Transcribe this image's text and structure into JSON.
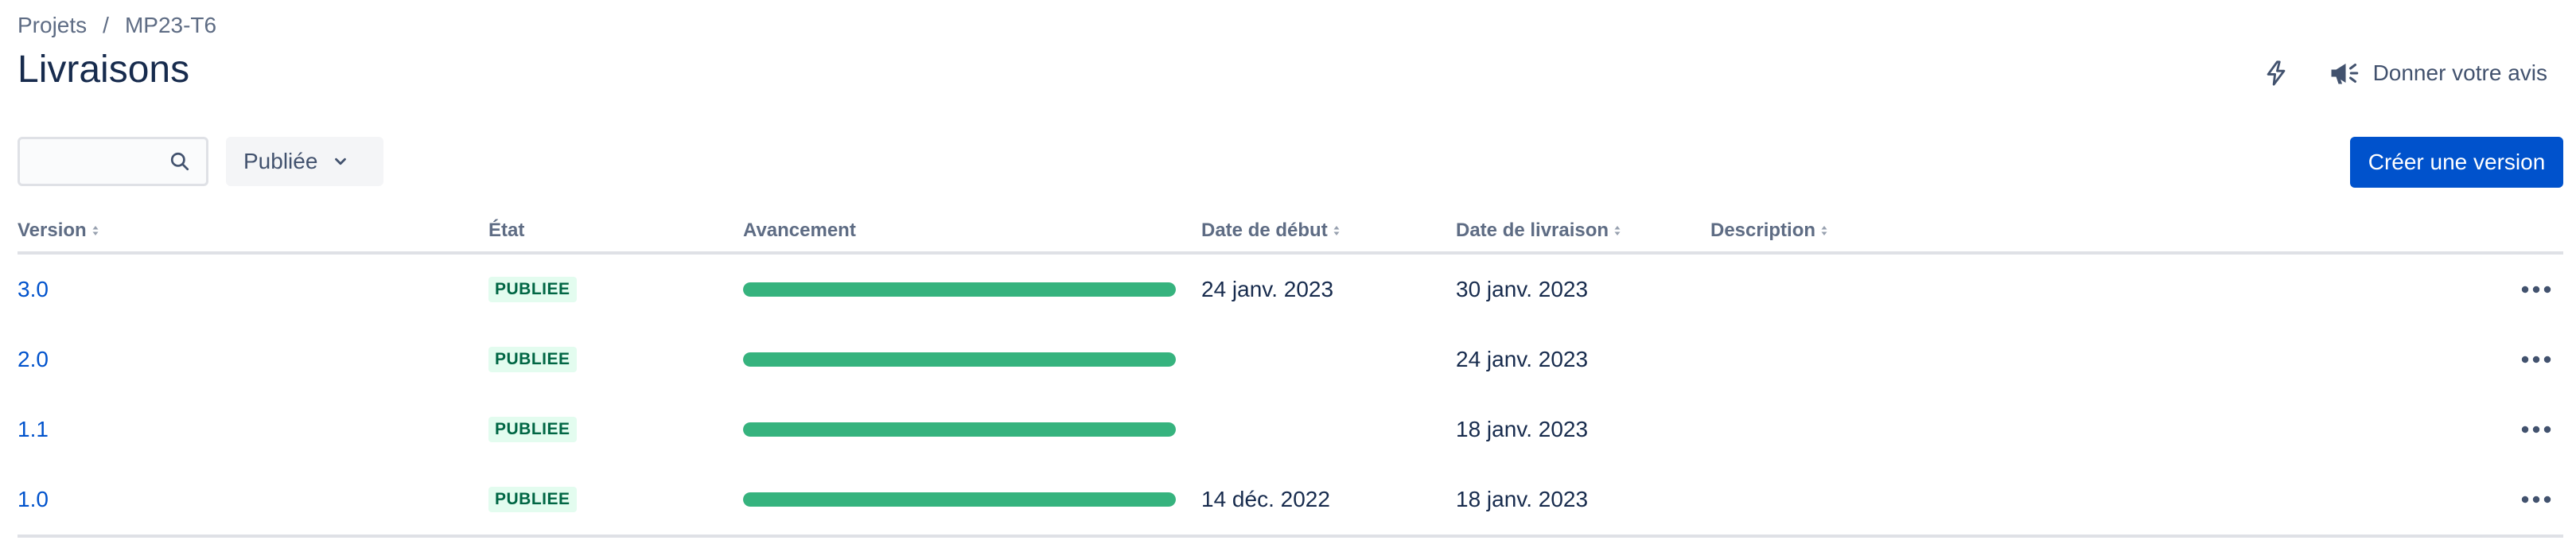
{
  "breadcrumb": {
    "root": "Projets",
    "separator": "/",
    "project": "MP23-T6"
  },
  "page": {
    "title": "Livraisons"
  },
  "header": {
    "feedback_label": "Donner votre avis",
    "icons": [
      "lightning-icon",
      "megaphone-icon"
    ]
  },
  "toolbar": {
    "search": {
      "value": "",
      "placeholder": ""
    },
    "status_filter": {
      "selected": "Publiée"
    },
    "create_label": "Créer une version"
  },
  "table": {
    "columns": {
      "version": "Version",
      "state": "État",
      "progress": "Avancement",
      "start_date": "Date de début",
      "release_date": "Date de livraison",
      "description": "Description"
    },
    "rows": [
      {
        "version": "3.0",
        "state": "PUBLIEE",
        "progress_pct": 100,
        "start_date": "24 janv. 2023",
        "release_date": "30 janv. 2023",
        "description": ""
      },
      {
        "version": "2.0",
        "state": "PUBLIEE",
        "progress_pct": 100,
        "start_date": "",
        "release_date": "24 janv. 2023",
        "description": ""
      },
      {
        "version": "1.1",
        "state": "PUBLIEE",
        "progress_pct": 100,
        "start_date": "",
        "release_date": "18 janv. 2023",
        "description": ""
      },
      {
        "version": "1.0",
        "state": "PUBLIEE",
        "progress_pct": 100,
        "start_date": "14 déc. 2022",
        "release_date": "18 janv. 2023",
        "description": ""
      }
    ]
  },
  "colors": {
    "accent": "#0052cc",
    "success": "#36b37e",
    "lozenge_bg": "#e3fcef",
    "lozenge_text": "#006644"
  }
}
